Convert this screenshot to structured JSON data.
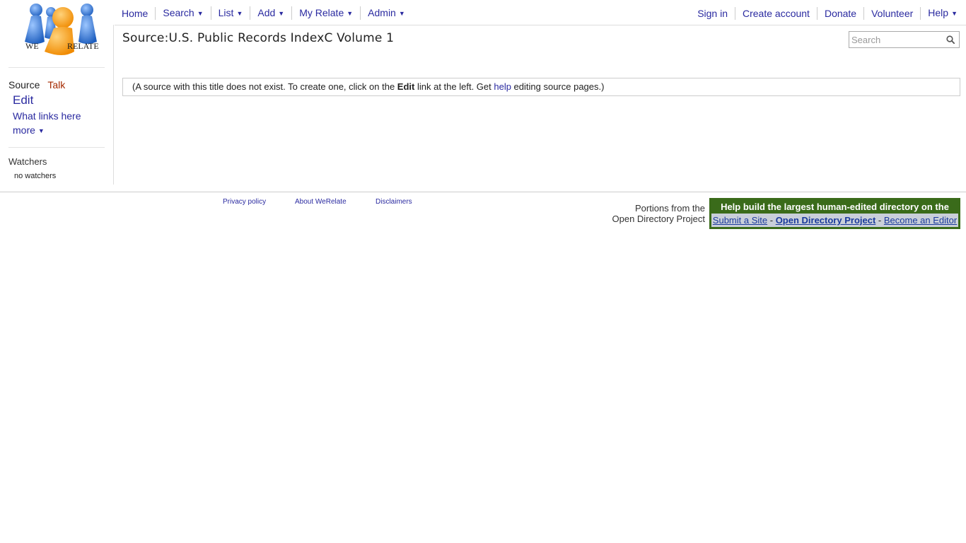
{
  "logo": {
    "text_left": "WE",
    "text_right": "RELATE"
  },
  "nav": {
    "left": [
      {
        "label": "Home",
        "has_arrow": false
      },
      {
        "label": "Search",
        "has_arrow": true
      },
      {
        "label": "List",
        "has_arrow": true
      },
      {
        "label": "Add",
        "has_arrow": true
      },
      {
        "label": "My Relate",
        "has_arrow": true
      },
      {
        "label": "Admin",
        "has_arrow": true
      }
    ],
    "right": [
      {
        "label": "Sign in",
        "has_arrow": false
      },
      {
        "label": "Create account",
        "has_arrow": false
      },
      {
        "label": "Donate",
        "has_arrow": false
      },
      {
        "label": "Volunteer",
        "has_arrow": false
      },
      {
        "label": "Help",
        "has_arrow": true
      }
    ],
    "arrow_glyph": "▼"
  },
  "search": {
    "placeholder": "Search"
  },
  "page": {
    "title": "Source:U.S. Public Records IndexC Volume 1",
    "notice": {
      "part1": "(A source with this title does not exist. To create one, click on the ",
      "bold": "Edit",
      "part2": " link at the left. Get ",
      "link": "help",
      "part3": " editing source pages.)"
    }
  },
  "sidebar": {
    "tab_source": "Source",
    "tab_talk": "Talk",
    "edit": "Edit",
    "what_links_here": "What links here",
    "more": "more",
    "watchers_title": "Watchers",
    "no_watchers": "no watchers"
  },
  "footer": {
    "privacy": "Privacy policy",
    "about": "About WeRelate",
    "disclaimers": "Disclaimers",
    "odp_portions_line1": "Portions from the",
    "odp_portions_line2": "Open Directory Project",
    "odp_headline": "Help build the largest human-edited directory on the web.",
    "odp_submit": "Submit a Site",
    "odp_sep": " - ",
    "odp_project": "Open Directory Project",
    "odp_editor": "Become an Editor"
  },
  "colors": {
    "link": "#2a2aa0",
    "talk": "#a52a00",
    "odp_green": "#3a6b1a",
    "odp_bar": "#c9cfd9",
    "logo_blue": "#3b7fd6",
    "logo_orange": "#f59a00"
  }
}
